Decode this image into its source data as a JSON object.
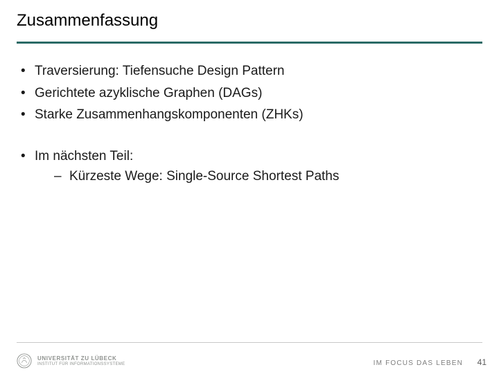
{
  "title": "Zusammenfassung",
  "bullets": {
    "g1": {
      "i0": "Traversierung: Tiefensuche Design Pattern",
      "i1": "Gerichtete azyklische Graphen (DAGs)",
      "i2": "Starke Zusammenhangskomponenten (ZHKs)"
    },
    "g2": {
      "i0": "Im nächsten Teil:",
      "sub": {
        "s0": "Kürzeste Wege: Single-Source Shortest Paths"
      }
    }
  },
  "footer": {
    "uni_line1": "UNIVERSITÄT ZU LÜBECK",
    "uni_line2": "INSTITUT FÜR INFORMATIONSSYSTEME",
    "tagline": "IM FOCUS DAS LEBEN",
    "page": "41"
  },
  "colors": {
    "accent": "#2a6a66"
  }
}
